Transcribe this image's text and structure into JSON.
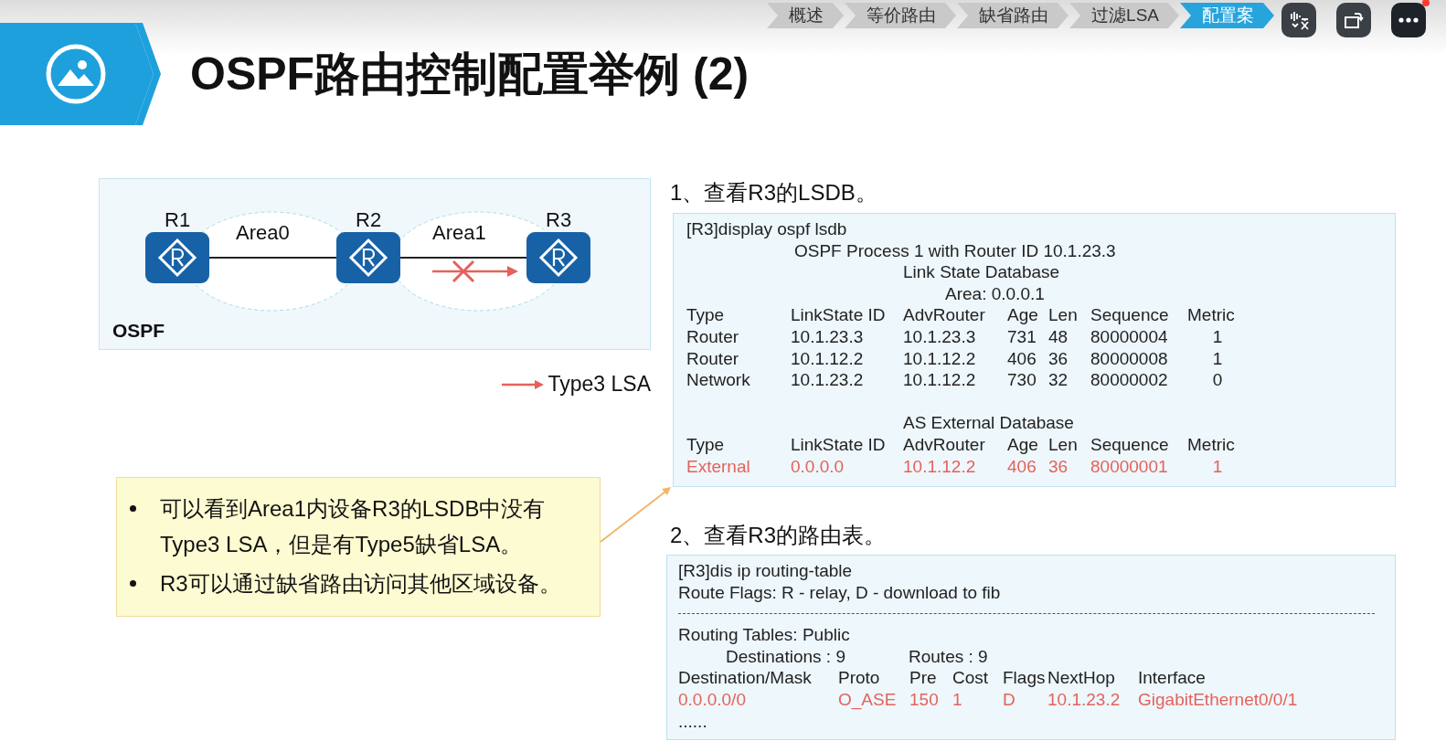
{
  "nav": {
    "tabs": [
      {
        "label": "概述",
        "selected": false
      },
      {
        "label": "等价路由",
        "selected": false
      },
      {
        "label": "缺省路由",
        "selected": false
      },
      {
        "label": "过滤LSA",
        "selected": false
      },
      {
        "label": "配置案",
        "selected": true
      }
    ]
  },
  "slide": {
    "title": "OSPF路由控制配置举例 (2)",
    "topology": {
      "routers": [
        {
          "label": "R1"
        },
        {
          "label": "R2"
        },
        {
          "label": "R3"
        }
      ],
      "areas": [
        {
          "label": "Area0"
        },
        {
          "label": "Area1"
        }
      ],
      "domain_label": "OSPF",
      "blocked_lsa": true
    },
    "legend": {
      "label": "Type3 LSA"
    },
    "notes": [
      "可以看到Area1内设备R3的LSDB中没有Type3 LSA，但是有Type5缺省LSA。",
      "R3可以通过缺省路由访问其他区域设备。"
    ],
    "lsdb": {
      "heading": "1、查看R3的LSDB。",
      "lines": [
        "[R3]display ospf lsdb",
        "OSPF Process 1 with Router ID 10.1.23.3",
        "Link State Database",
        "Area: 0.0.0.1"
      ],
      "columns": [
        "Type",
        "LinkState ID",
        "AdvRouter",
        "Age",
        "Len",
        "Sequence",
        "Metric"
      ],
      "rows": [
        {
          "cells": [
            "Router",
            "10.1.23.3",
            "10.1.23.3",
            "731",
            "48",
            "80000004",
            "1"
          ],
          "highlighted": false
        },
        {
          "cells": [
            "Router",
            "10.1.12.2",
            "10.1.12.2",
            "406",
            "36",
            "80000008",
            "1"
          ],
          "highlighted": false
        },
        {
          "cells": [
            "Network",
            "10.1.23.2",
            "10.1.12.2",
            "730",
            "32",
            "80000002",
            "0"
          ],
          "highlighted": false
        }
      ],
      "external_title": "AS External Database",
      "external_columns": [
        "Type",
        "LinkState ID",
        "AdvRouter",
        "Age",
        "Len",
        "Sequence",
        "Metric"
      ],
      "external_rows": [
        {
          "cells": [
            "External",
            "0.0.0.0",
            "10.1.12.2",
            "406",
            "36",
            "80000001",
            "1"
          ],
          "highlighted": true
        }
      ]
    },
    "routing": {
      "heading": "2、查看R3的路由表。",
      "command": "[R3]dis ip routing-table",
      "flags": "Route Flags: R - relay, D - download to fib",
      "table_name": "Routing Tables: Public",
      "destinations": "Destinations : 9",
      "routes": "Routes : 9",
      "columns": [
        "Destination/Mask",
        "Proto",
        "Pre",
        "Cost",
        "Flags",
        "NextHop",
        "Interface"
      ],
      "rows": [
        {
          "cells": [
            "0.0.0.0/0",
            "O_ASE",
            "150",
            "1",
            "D",
            "10.1.23.2",
            "GigabitEthernet0/0/1"
          ],
          "highlighted": true
        }
      ],
      "more": "......"
    }
  }
}
